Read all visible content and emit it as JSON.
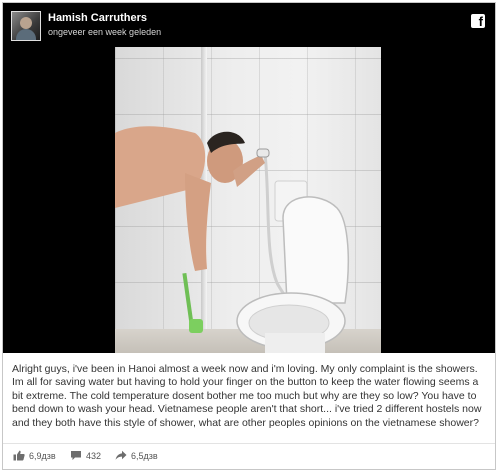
{
  "post": {
    "author": "Hamish Carruthers",
    "timestamp": "ongeveer een week geleden",
    "caption": "Alright guys, i've been in Hanoi almost a week now and i'm loving. My only complaint is the showers. Im all for saving water but having to hold your finger on the button to keep the water flowing seems a bit extreme. The cold temperature dosent bother me too much but why are they so low? You have to bend down to wash your head. Vietnamese people aren't that short... i've tried 2 different hostels now and they both have this style of shower, what are other peoples opinions on the vietnamese shower?"
  },
  "platform": {
    "logo_letter": "f"
  },
  "stats": {
    "likes": "6,9дзв",
    "comments": "432",
    "shares": "6,5дзв"
  },
  "icons": {
    "platform": "facebook-icon",
    "like": "thumbs-up-icon",
    "comment": "comment-icon",
    "share": "share-icon"
  }
}
